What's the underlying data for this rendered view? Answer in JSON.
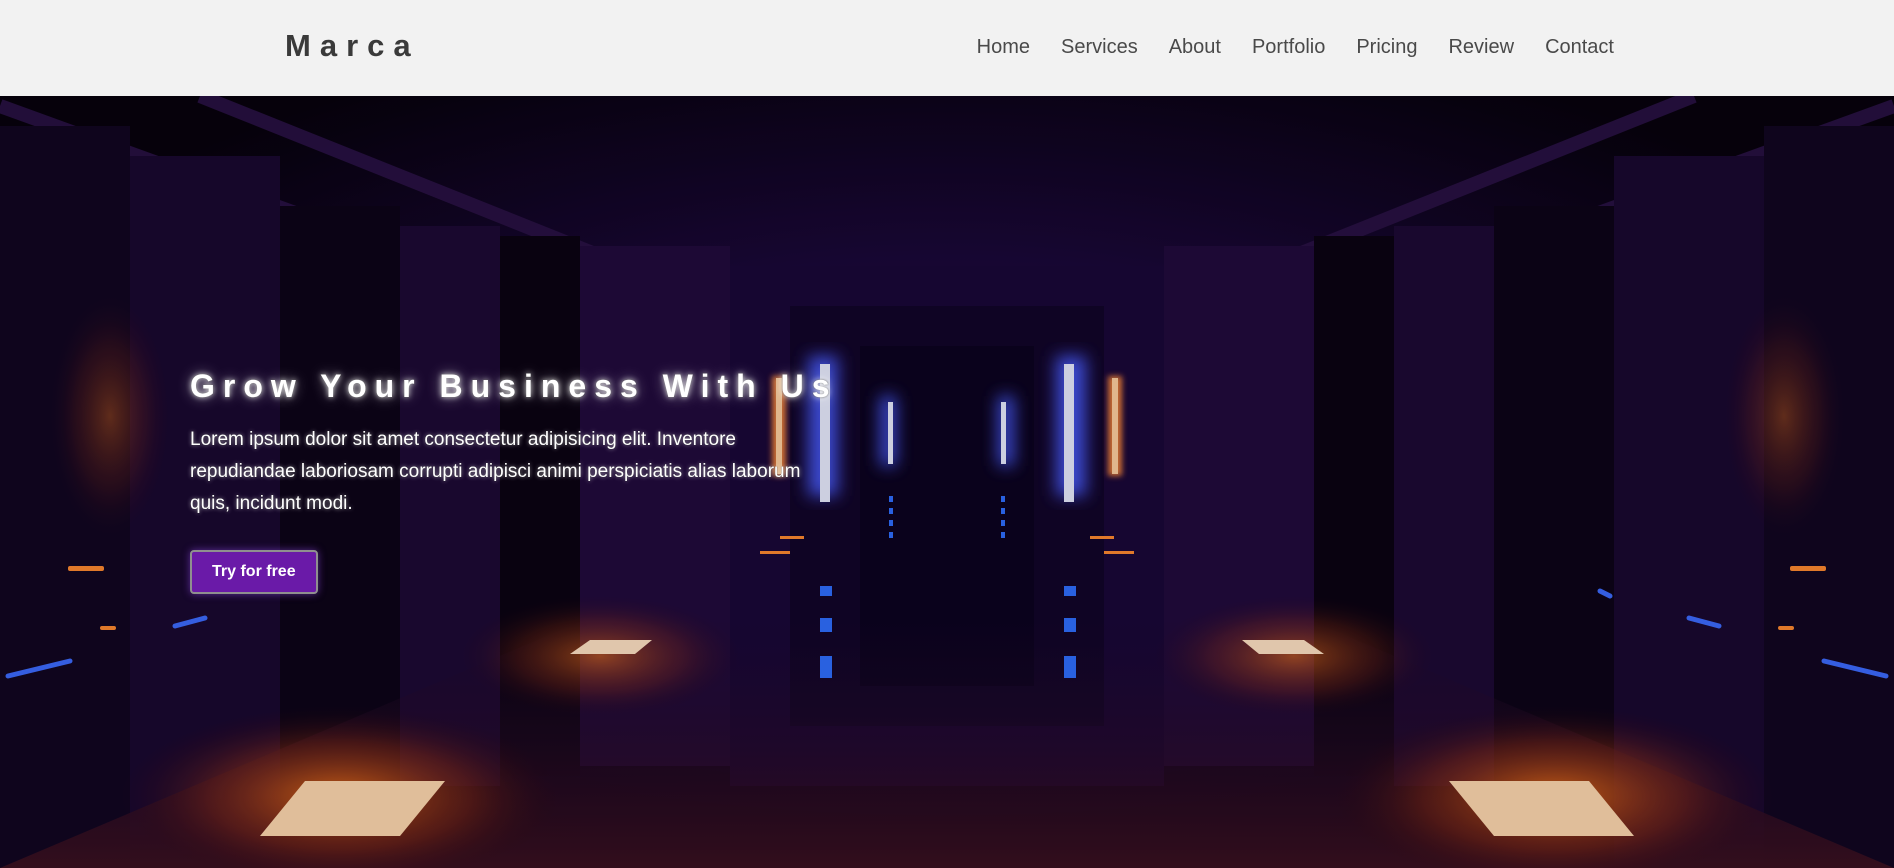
{
  "header": {
    "logo": "Marca",
    "nav": [
      "Home",
      "Services",
      "About",
      "Portfolio",
      "Pricing",
      "Review",
      "Contact"
    ]
  },
  "hero": {
    "title": "Grow Your Business With Us",
    "text": "Lorem ipsum dolor sit amet consectetur adipisicing elit. Inventore repudiandae laboriosam corrupti adipisci animi perspiciatis alias laborum quis, incidunt modi.",
    "cta_label": "Try for free"
  },
  "colors": {
    "header_bg": "#f2f2f2",
    "nav_text": "#4a4a4a",
    "logo_text": "#3a3a3a",
    "cta_bg": "#6a1aa8",
    "hero_bg": "#0b0418"
  }
}
